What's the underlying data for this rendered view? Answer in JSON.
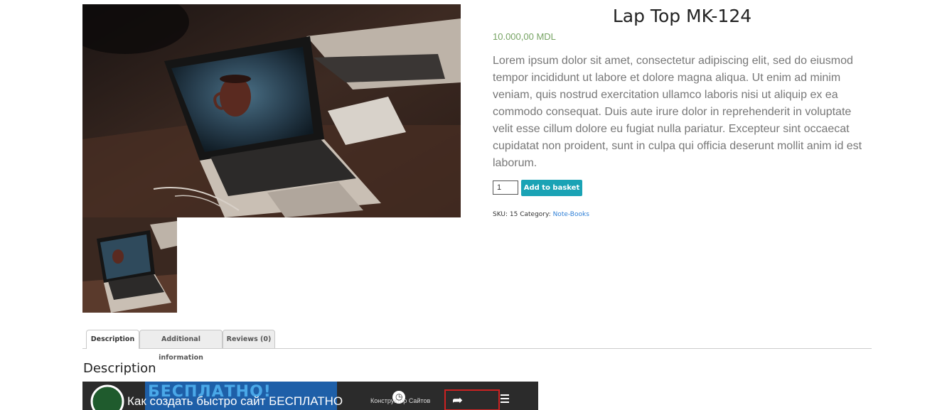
{
  "product": {
    "title": "Lap Top MK-124",
    "price": "10.000,00 MDL",
    "description": "Lorem ipsum dolor sit amet, consectetur adipiscing elit, sed do eiusmod tempor incididunt ut labore et dolore magna aliqua. Ut enim ad minim veniam, quis nostrud exercitation ullamco laboris nisi ut aliquip ex ea commodo consequat. Duis aute irure dolor in reprehenderit in voluptate velit esse cillum dolore eu fugiat nulla pariatur. Excepteur sint occaecat cupidatat non proident, sunt in culpa qui officia deserunt mollit anim id est laborum.",
    "quantity": "1",
    "add_to_basket_label": "Add to basket",
    "sku_label": "SKU:",
    "sku_value": "15",
    "category_label": "Category:",
    "category_value": "Note-Books"
  },
  "tabs": [
    {
      "label": "Description",
      "active": true
    },
    {
      "label": "Additional information",
      "active": false
    },
    {
      "label": "Reviews (0)",
      "active": false
    }
  ],
  "description_section": {
    "heading": "Description"
  },
  "video": {
    "banner_text": "БЕСПЛАТНО!",
    "title_text": "Как создать быстро сайт БЕСПЛАТНО",
    "side_text": "Конструктор Сайтов"
  },
  "colors": {
    "price": "#77a464",
    "button": "#1aa3b5",
    "link": "#2e7fd6"
  }
}
